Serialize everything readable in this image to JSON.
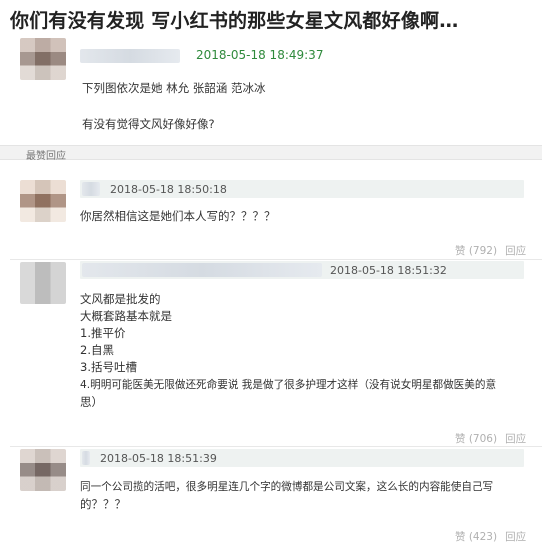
{
  "title": "你们有没有发现 写小红书的那些女星文风都好像啊…",
  "post": {
    "time": "2018-05-18 18:49:37",
    "body_line1": "下列图依次是她 林允 张韶涵 范冰冰",
    "body_line2": "有没有觉得文风好像好像?"
  },
  "section_label": "最赞回应",
  "comments": [
    {
      "time": "2018-05-18 18:50:18",
      "lines": [
        "你居然相信这是她们本人写的？？？？"
      ],
      "likes": "赞 (792)",
      "reply": "回应"
    },
    {
      "time": "2018-05-18 18:51:32",
      "lines": [
        "文风都是批发的",
        "大概套路基本就是",
        "1.推平价",
        "2.自黑",
        "3.括号吐槽",
        "4.明明可能医美无限做还死命要说 我是做了很多护理才这样（没有说女明星都做医美的意",
        "思）"
      ],
      "likes": "赞 (706)",
      "reply": "回应"
    },
    {
      "time": "2018-05-18 18:51:39",
      "lines": [
        "同一个公司揽的活吧，很多明星连几个字的微博都是公司文案，这么长的内容能使自己写",
        "的？？？"
      ],
      "likes": "赞 (423)",
      "reply": "回应"
    }
  ]
}
